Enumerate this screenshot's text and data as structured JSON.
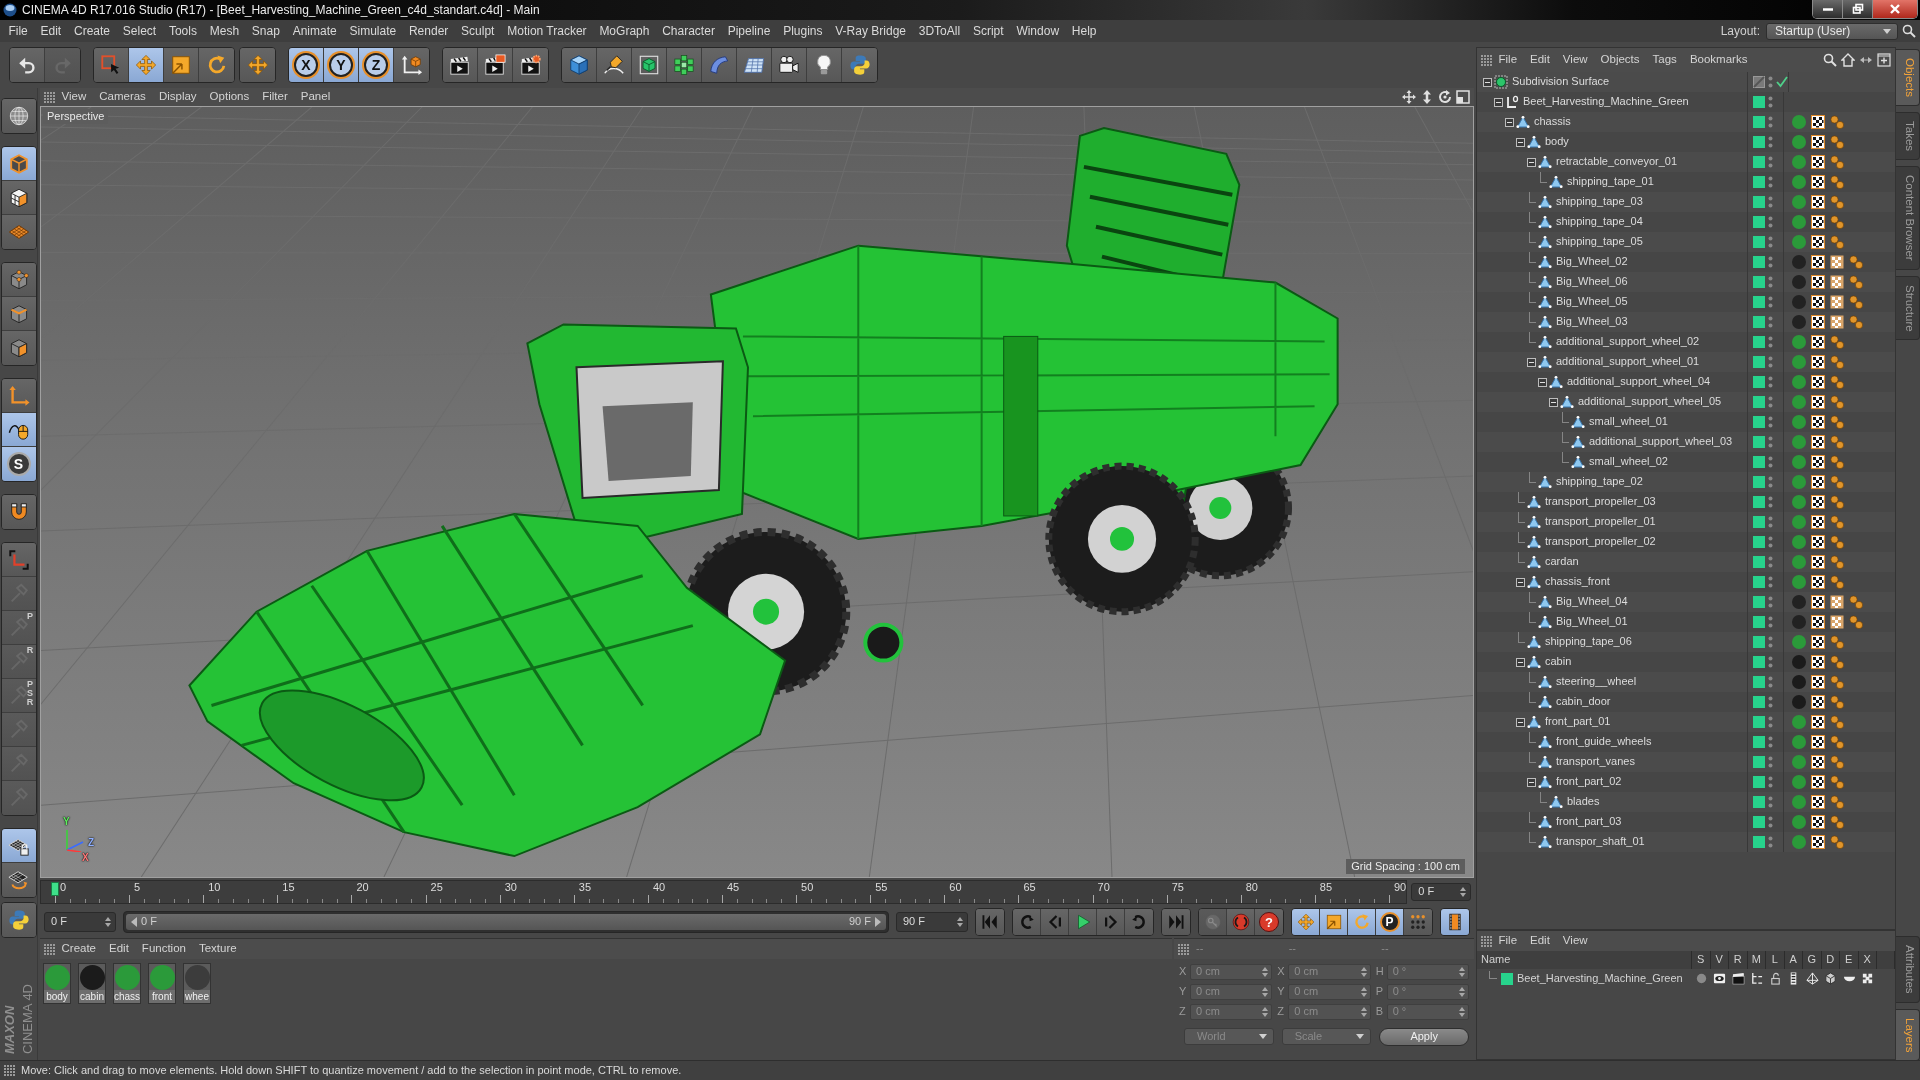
{
  "window": {
    "title": "CINEMA 4D R17.016 Studio (R17) - [Beet_Harvesting_Machine_Green_c4d_standart.c4d] - Main"
  },
  "menu": [
    "File",
    "Edit",
    "Create",
    "Select",
    "Tools",
    "Mesh",
    "Snap",
    "Animate",
    "Simulate",
    "Render",
    "Sculpt",
    "Motion Tracker",
    "MoGraph",
    "Character",
    "Pipeline",
    "Plugins",
    "V-Ray Bridge",
    "3DToAll",
    "Script",
    "Window",
    "Help"
  ],
  "layout": {
    "label": "Layout:",
    "value": "Startup (User)"
  },
  "toolbar": [
    [
      {
        "on": false,
        "disabled": false
      },
      {
        "on": false,
        "disabled": true
      }
    ],
    [
      {
        "on": false
      },
      {
        "on": true
      },
      {
        "on": false
      },
      {
        "on": false
      }
    ],
    [
      {
        "on": false
      }
    ],
    [
      {
        "on": true,
        "label": "X"
      },
      {
        "on": true,
        "label": "Y"
      },
      {
        "on": true,
        "label": "Z"
      },
      {
        "on": false
      }
    ],
    [
      {
        "on": false
      },
      {
        "on": false
      },
      {
        "on": false
      }
    ],
    [
      {
        "on": false
      },
      {
        "on": false
      },
      {
        "on": false
      },
      {
        "on": false
      },
      {
        "on": false
      },
      {
        "on": false
      },
      {
        "on": false
      },
      {
        "on": false
      },
      {
        "on": false
      }
    ]
  ],
  "left_toolbar": [
    [
      {
        "on": false
      }
    ],
    [
      {
        "on": true
      },
      {
        "on": false
      },
      {
        "on": false
      }
    ],
    [
      {
        "on": false
      },
      {
        "on": false
      },
      {
        "on": false
      }
    ],
    [
      {
        "on": false
      },
      {
        "on": true
      },
      {
        "on": true,
        "label": "S"
      }
    ],
    [
      {
        "on": false
      }
    ],
    [
      {
        "on": false,
        "disabled": false
      },
      {
        "on": false,
        "disabled": true
      },
      {
        "on": false,
        "disabled": true,
        "label": "P"
      },
      {
        "on": false,
        "disabled": true,
        "label": "R"
      },
      {
        "on": false,
        "disabled": true,
        "label": "PSR"
      },
      {
        "on": false,
        "disabled": true
      },
      {
        "on": false,
        "disabled": true
      },
      {
        "on": false,
        "disabled": true
      }
    ],
    [
      {
        "on": true
      },
      {
        "on": false
      }
    ],
    [
      {
        "on": false
      }
    ]
  ],
  "viewport": {
    "menu": [
      "View",
      "Cameras",
      "Display",
      "Options",
      "Filter",
      "Panel"
    ],
    "camera": "Perspective",
    "axes": [
      "Y",
      "Z",
      "X"
    ],
    "grid_spacing": "Grid Spacing : 100 cm"
  },
  "timeline": {
    "ticks": [
      "0",
      "5",
      "10",
      "15",
      "20",
      "25",
      "30",
      "35",
      "40",
      "45",
      "50",
      "55",
      "60",
      "65",
      "70",
      "75",
      "80",
      "85",
      "90"
    ],
    "level": 0,
    "frame": "0 F"
  },
  "playback": {
    "start": "0 F",
    "range": {
      "start": "0 F",
      "end": "90 F",
      "level": 1
    },
    "end": "90 F",
    "record": [
      {
        "disabled": true
      },
      {
        "disabled": false
      },
      {
        "disabled": false,
        "label": "?"
      }
    ],
    "modes": [
      {
        "on": true
      },
      {
        "on": true
      },
      {
        "on": true
      },
      {
        "on": true,
        "label": "P"
      },
      {
        "on": false
      }
    ],
    "timeline_button": {
      "on": true
    }
  },
  "materials": {
    "menu": [
      "Create",
      "Edit",
      "Function",
      "Texture"
    ],
    "items": [
      {
        "name": "body",
        "color": "#2b9a3a"
      },
      {
        "name": "cabin",
        "color": "#1b1b1b"
      },
      {
        "name": "chass",
        "color": "#2b9a3a"
      },
      {
        "name": "front",
        "color": "#2b9a3a"
      },
      {
        "name": "whee",
        "color": "#3c3c3c"
      }
    ]
  },
  "coordinates": {
    "disabled": true,
    "headers": [
      "--",
      "--",
      "--"
    ],
    "rows": [
      [
        {
          "axis": "X",
          "value": "0 cm"
        },
        {
          "axis": "X",
          "value": "0 cm"
        },
        {
          "axis": "H",
          "value": "0 °"
        }
      ],
      [
        {
          "axis": "Y",
          "value": "0 cm"
        },
        {
          "axis": "Y",
          "value": "0 cm"
        },
        {
          "axis": "P",
          "value": "0 °"
        }
      ],
      [
        {
          "axis": "Z",
          "value": "0 cm"
        },
        {
          "axis": "Z",
          "value": "0 cm"
        },
        {
          "axis": "B",
          "value": "0 °"
        }
      ]
    ],
    "dropdowns": [
      "World",
      "Scale"
    ],
    "apply": "Apply"
  },
  "objects": {
    "menu": [
      "File",
      "Edit",
      "View",
      "Objects",
      "Tags",
      "Bookmarks"
    ],
    "tree": [
      {
        "name": "Subdivision Surface",
        "kind": "subdivision",
        "layer": false,
        "enabled": true,
        "expanded": true,
        "children": [
          {
            "name": "Beet_Harvesting_Machine_Green",
            "kind": "null",
            "layer": true,
            "expanded": true,
            "children": [
              {
                "name": "chassis",
                "kind": "polygon",
                "layer": true,
                "tags": [
                  {
                    "kind": "material",
                    "color": "#2b9a3a"
                  },
                  {
                    "kind": "checker"
                  },
                  {
                    "kind": "phong"
                  }
                ],
                "expanded": true,
                "children": [
                  {
                    "name": "body",
                    "kind": "polygon",
                    "layer": true,
                    "tags": [
                      {
                        "kind": "material",
                        "color": "#2b9a3a"
                      },
                      {
                        "kind": "checker"
                      },
                      {
                        "kind": "phong"
                      }
                    ],
                    "expanded": true,
                    "children": [
                      {
                        "name": "retractable_conveyor_01",
                        "kind": "polygon",
                        "layer": true,
                        "tags": [
                          {
                            "kind": "material",
                            "color": "#2b9a3a"
                          },
                          {
                            "kind": "checker"
                          },
                          {
                            "kind": "phong"
                          }
                        ],
                        "expanded": true,
                        "children": [
                          {
                            "name": "shipping_tape_01",
                            "kind": "polygon",
                            "layer": true,
                            "tags": [
                              {
                                "kind": "material",
                                "color": "#2b9a3a"
                              },
                              {
                                "kind": "checker"
                              },
                              {
                                "kind": "phong"
                              }
                            ]
                          }
                        ]
                      },
                      {
                        "name": "shipping_tape_03",
                        "kind": "polygon",
                        "layer": true,
                        "tags": [
                          {
                            "kind": "material",
                            "color": "#2b9a3a"
                          },
                          {
                            "kind": "checker"
                          },
                          {
                            "kind": "phong"
                          }
                        ]
                      },
                      {
                        "name": "shipping_tape_04",
                        "kind": "polygon",
                        "layer": true,
                        "tags": [
                          {
                            "kind": "material",
                            "color": "#2b9a3a"
                          },
                          {
                            "kind": "checker"
                          },
                          {
                            "kind": "phong"
                          }
                        ]
                      },
                      {
                        "name": "shipping_tape_05",
                        "kind": "polygon",
                        "layer": true,
                        "tags": [
                          {
                            "kind": "material",
                            "color": "#2b9a3a"
                          },
                          {
                            "kind": "checker"
                          },
                          {
                            "kind": "phong"
                          }
                        ]
                      },
                      {
                        "name": "Big_Wheel_02",
                        "kind": "polygon",
                        "layer": true,
                        "tags": [
                          {
                            "kind": "material",
                            "color": "#222222"
                          },
                          {
                            "kind": "checker"
                          },
                          {
                            "kind": "pattern"
                          },
                          {
                            "kind": "phong"
                          }
                        ]
                      },
                      {
                        "name": "Big_Wheel_06",
                        "kind": "polygon",
                        "layer": true,
                        "tags": [
                          {
                            "kind": "material",
                            "color": "#222222"
                          },
                          {
                            "kind": "checker"
                          },
                          {
                            "kind": "pattern"
                          },
                          {
                            "kind": "phong"
                          }
                        ]
                      },
                      {
                        "name": "Big_Wheel_05",
                        "kind": "polygon",
                        "layer": true,
                        "tags": [
                          {
                            "kind": "material",
                            "color": "#222222"
                          },
                          {
                            "kind": "checker"
                          },
                          {
                            "kind": "pattern"
                          },
                          {
                            "kind": "phong"
                          }
                        ]
                      },
                      {
                        "name": "Big_Wheel_03",
                        "kind": "polygon",
                        "layer": true,
                        "tags": [
                          {
                            "kind": "material",
                            "color": "#222222"
                          },
                          {
                            "kind": "checker"
                          },
                          {
                            "kind": "pattern"
                          },
                          {
                            "kind": "phong"
                          }
                        ]
                      },
                      {
                        "name": "additional_support_wheel_02",
                        "kind": "polygon",
                        "layer": true,
                        "tags": [
                          {
                            "kind": "material",
                            "color": "#2b9a3a"
                          },
                          {
                            "kind": "checker"
                          },
                          {
                            "kind": "phong"
                          }
                        ]
                      },
                      {
                        "name": "additional_support_wheel_01",
                        "kind": "polygon",
                        "layer": true,
                        "tags": [
                          {
                            "kind": "material",
                            "color": "#2b9a3a"
                          },
                          {
                            "kind": "checker"
                          },
                          {
                            "kind": "phong"
                          }
                        ],
                        "expanded": true,
                        "children": [
                          {
                            "name": "additional_support_wheel_04",
                            "kind": "polygon",
                            "layer": true,
                            "tags": [
                              {
                                "kind": "material",
                                "color": "#2b9a3a"
                              },
                              {
                                "kind": "checker"
                              },
                              {
                                "kind": "phong"
                              }
                            ],
                            "expanded": true,
                            "children": [
                              {
                                "name": "additional_support_wheel_05",
                                "kind": "polygon",
                                "layer": true,
                                "tags": [
                                  {
                                    "kind": "material",
                                    "color": "#2b9a3a"
                                  },
                                  {
                                    "kind": "checker"
                                  },
                                  {
                                    "kind": "phong"
                                  }
                                ],
                                "expanded": true,
                                "children": [
                                  {
                                    "name": "small_wheel_01",
                                    "kind": "polygon",
                                    "layer": true,
                                    "tags": [
                                      {
                                        "kind": "material",
                                        "color": "#2b9a3a"
                                      },
                                      {
                                        "kind": "checker"
                                      },
                                      {
                                        "kind": "phong"
                                      }
                                    ]
                                  },
                                  {
                                    "name": "additional_support_wheel_03",
                                    "kind": "polygon",
                                    "layer": true,
                                    "tags": [
                                      {
                                        "kind": "material",
                                        "color": "#2b9a3a"
                                      },
                                      {
                                        "kind": "checker"
                                      },
                                      {
                                        "kind": "phong"
                                      }
                                    ]
                                  },
                                  {
                                    "name": "small_wheel_02",
                                    "kind": "polygon",
                                    "layer": true,
                                    "tags": [
                                      {
                                        "kind": "material",
                                        "color": "#2b9a3a"
                                      },
                                      {
                                        "kind": "checker"
                                      },
                                      {
                                        "kind": "phong"
                                      }
                                    ]
                                  }
                                ]
                              }
                            ]
                          }
                        ]
                      },
                      {
                        "name": "shipping_tape_02",
                        "kind": "polygon",
                        "layer": true,
                        "tags": [
                          {
                            "kind": "material",
                            "color": "#2b9a3a"
                          },
                          {
                            "kind": "checker"
                          },
                          {
                            "kind": "phong"
                          }
                        ]
                      }
                    ]
                  },
                  {
                    "name": "transport_propeller_03",
                    "kind": "polygon",
                    "layer": true,
                    "tags": [
                      {
                        "kind": "material",
                        "color": "#2b9a3a"
                      },
                      {
                        "kind": "checker"
                      },
                      {
                        "kind": "phong"
                      }
                    ]
                  },
                  {
                    "name": "transport_propeller_01",
                    "kind": "polygon",
                    "layer": true,
                    "tags": [
                      {
                        "kind": "material",
                        "color": "#2b9a3a"
                      },
                      {
                        "kind": "checker"
                      },
                      {
                        "kind": "phong"
                      }
                    ]
                  },
                  {
                    "name": "transport_propeller_02",
                    "kind": "polygon",
                    "layer": true,
                    "tags": [
                      {
                        "kind": "material",
                        "color": "#2b9a3a"
                      },
                      {
                        "kind": "checker"
                      },
                      {
                        "kind": "phong"
                      }
                    ]
                  },
                  {
                    "name": "cardan",
                    "kind": "polygon",
                    "layer": true,
                    "tags": [
                      {
                        "kind": "material",
                        "color": "#2b9a3a"
                      },
                      {
                        "kind": "checker"
                      },
                      {
                        "kind": "phong"
                      }
                    ]
                  },
                  {
                    "name": "chassis_front",
                    "kind": "polygon",
                    "layer": true,
                    "tags": [
                      {
                        "kind": "material",
                        "color": "#2b9a3a"
                      },
                      {
                        "kind": "checker"
                      },
                      {
                        "kind": "phong"
                      }
                    ],
                    "expanded": true,
                    "children": [
                      {
                        "name": "Big_Wheel_04",
                        "kind": "polygon",
                        "layer": true,
                        "tags": [
                          {
                            "kind": "material",
                            "color": "#222222"
                          },
                          {
                            "kind": "checker"
                          },
                          {
                            "kind": "pattern"
                          },
                          {
                            "kind": "phong"
                          }
                        ]
                      },
                      {
                        "name": "Big_Wheel_01",
                        "kind": "polygon",
                        "layer": true,
                        "tags": [
                          {
                            "kind": "material",
                            "color": "#222222"
                          },
                          {
                            "kind": "checker"
                          },
                          {
                            "kind": "pattern"
                          },
                          {
                            "kind": "phong"
                          }
                        ]
                      }
                    ]
                  },
                  {
                    "name": "shipping_tape_06",
                    "kind": "polygon",
                    "layer": true,
                    "tags": [
                      {
                        "kind": "material",
                        "color": "#2b9a3a"
                      },
                      {
                        "kind": "checker"
                      },
                      {
                        "kind": "phong"
                      }
                    ]
                  },
                  {
                    "name": "cabin",
                    "kind": "polygon",
                    "layer": true,
                    "tags": [
                      {
                        "kind": "material",
                        "color": "#1b1b1b"
                      },
                      {
                        "kind": "checker"
                      },
                      {
                        "kind": "phong"
                      }
                    ],
                    "expanded": true,
                    "children": [
                      {
                        "name": "steering__wheel",
                        "kind": "polygon",
                        "layer": true,
                        "tags": [
                          {
                            "kind": "material",
                            "color": "#1b1b1b"
                          },
                          {
                            "kind": "checker"
                          },
                          {
                            "kind": "phong"
                          }
                        ]
                      },
                      {
                        "name": "cabin_door",
                        "kind": "polygon",
                        "layer": true,
                        "tags": [
                          {
                            "kind": "material",
                            "color": "#1b1b1b"
                          },
                          {
                            "kind": "checker"
                          },
                          {
                            "kind": "phong"
                          }
                        ]
                      }
                    ]
                  },
                  {
                    "name": "front_part_01",
                    "kind": "polygon",
                    "layer": true,
                    "tags": [
                      {
                        "kind": "material",
                        "color": "#2b9a3a"
                      },
                      {
                        "kind": "checker"
                      },
                      {
                        "kind": "phong"
                      }
                    ],
                    "expanded": true,
                    "children": [
                      {
                        "name": "front_guide_wheels",
                        "kind": "polygon",
                        "layer": true,
                        "tags": [
                          {
                            "kind": "material",
                            "color": "#2b9a3a"
                          },
                          {
                            "kind": "checker"
                          },
                          {
                            "kind": "phong"
                          }
                        ]
                      },
                      {
                        "name": "transport_vanes",
                        "kind": "polygon",
                        "layer": true,
                        "tags": [
                          {
                            "kind": "material",
                            "color": "#2b9a3a"
                          },
                          {
                            "kind": "checker"
                          },
                          {
                            "kind": "phong"
                          }
                        ]
                      },
                      {
                        "name": "front_part_02",
                        "kind": "polygon",
                        "layer": true,
                        "tags": [
                          {
                            "kind": "material",
                            "color": "#2b9a3a"
                          },
                          {
                            "kind": "checker"
                          },
                          {
                            "kind": "phong"
                          }
                        ],
                        "expanded": true,
                        "children": [
                          {
                            "name": "blades",
                            "kind": "polygon",
                            "layer": true,
                            "tags": [
                              {
                                "kind": "material",
                                "color": "#2b9a3a"
                              },
                              {
                                "kind": "checker"
                              },
                              {
                                "kind": "phong"
                              }
                            ]
                          }
                        ]
                      },
                      {
                        "name": "front_part_03",
                        "kind": "polygon",
                        "layer": true,
                        "tags": [
                          {
                            "kind": "material",
                            "color": "#2b9a3a"
                          },
                          {
                            "kind": "checker"
                          },
                          {
                            "kind": "phong"
                          }
                        ]
                      },
                      {
                        "name": "transpor_shaft_01",
                        "kind": "polygon",
                        "layer": true,
                        "tags": [
                          {
                            "kind": "material",
                            "color": "#2b9a3a"
                          },
                          {
                            "kind": "checker"
                          },
                          {
                            "kind": "phong"
                          }
                        ]
                      }
                    ]
                  }
                ]
              }
            ]
          }
        ]
      }
    ]
  },
  "layers": {
    "menu": [
      "File",
      "Edit",
      "View"
    ],
    "columns": [
      "Name",
      "S",
      "V",
      "R",
      "M",
      "L",
      "A",
      "G",
      "D",
      "E",
      "X"
    ],
    "items": [
      {
        "name": "Beet_Harvesting_Machine_Green",
        "color": "#27d38c"
      }
    ]
  },
  "side_tabs": [
    {
      "label": "Objects",
      "selected": true
    },
    {
      "label": "Takes",
      "selected": false
    },
    {
      "label": "Content Browser",
      "selected": false
    },
    {
      "label": "Structure",
      "selected": false
    }
  ],
  "lower_side_tabs": [
    {
      "label": "Attributes",
      "selected": false
    },
    {
      "label": "Layers",
      "selected": true
    }
  ],
  "logo": {
    "brand": "MAXON",
    "product": "CINEMA 4D"
  },
  "status_bar": "Move: Click and drag to move elements. Hold down SHIFT to quantize movement / add to the selection in point mode, CTRL to remove."
}
